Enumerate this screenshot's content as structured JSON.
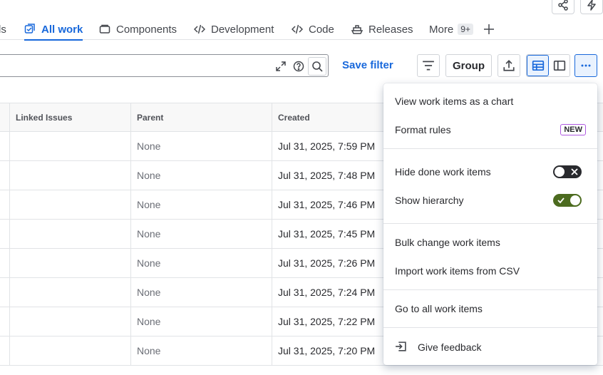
{
  "tabs": [
    {
      "label": "ls"
    },
    {
      "label": "All work"
    },
    {
      "label": "Components"
    },
    {
      "label": "Development"
    },
    {
      "label": "Code"
    },
    {
      "label": "Releases"
    },
    {
      "label": "More",
      "badge": "9+"
    }
  ],
  "toolbar": {
    "save_filter": "Save filter",
    "group": "Group"
  },
  "table": {
    "columns": [
      "Linked Issues",
      "Parent",
      "Created"
    ],
    "rows": [
      {
        "parent": "None",
        "created": "Jul 31, 2025, 7:59 PM"
      },
      {
        "parent": "None",
        "created": "Jul 31, 2025, 7:48 PM"
      },
      {
        "parent": "None",
        "created": "Jul 31, 2025, 7:46 PM"
      },
      {
        "parent": "None",
        "created": "Jul 31, 2025, 7:45 PM"
      },
      {
        "parent": "None",
        "created": "Jul 31, 2025, 7:26 PM"
      },
      {
        "parent": "None",
        "created": "Jul 31, 2025, 7:24 PM"
      },
      {
        "parent": "None",
        "created": "Jul 31, 2025, 7:22 PM"
      },
      {
        "parent": "None",
        "created": "Jul 31, 2025, 7:20 PM"
      }
    ]
  },
  "menu": {
    "view_chart": "View work items as a chart",
    "format_rules": "Format rules",
    "new_badge": "NEW",
    "hide_done": "Hide done work items",
    "hide_done_on": false,
    "show_hierarchy": "Show hierarchy",
    "show_hierarchy_on": true,
    "bulk_change": "Bulk change work items",
    "import_csv": "Import work items from CSV",
    "go_all": "Go to all work items",
    "feedback": "Give feedback"
  },
  "colors": {
    "accent": "#1868db",
    "toggle_on": "#4c6b1f",
    "toggle_off": "#292a2e"
  }
}
